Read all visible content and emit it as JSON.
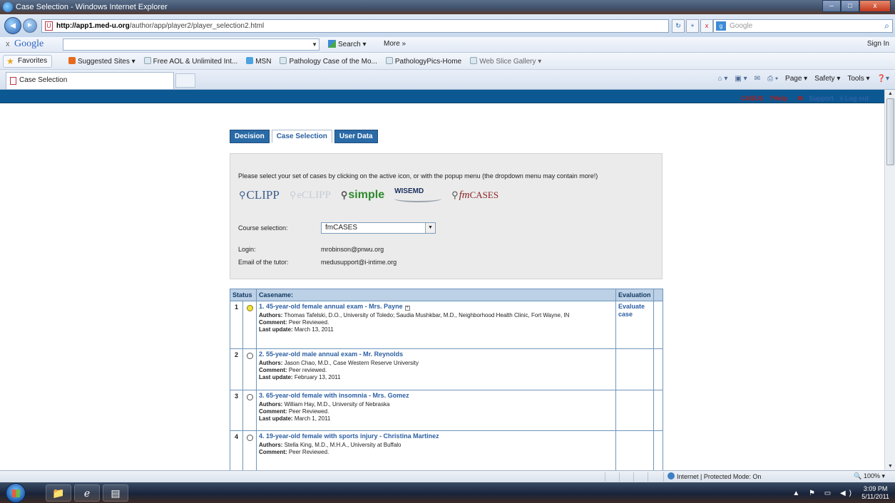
{
  "window": {
    "title": "Case Selection - Windows Internet Explorer",
    "minimize": "–",
    "maximize": "□",
    "close": "x"
  },
  "browser": {
    "back": "◄",
    "forward": "►",
    "url_domain": "http://app1.med-u.org",
    "url_path": "/author/app/player2/player_selection2.html",
    "addr_refresh": "↻",
    "addr_compat": "+",
    "addr_stop": "x",
    "google_box_text": "Google",
    "google_search_icon": "⌕",
    "google_toolbar": {
      "close": "x",
      "logo": "Google",
      "search_label": "Search ▾",
      "more_label": "More »",
      "signin_label": "Sign In"
    },
    "favorites": {
      "button_label": "Favorites",
      "links": [
        "Suggested Sites ▾",
        "Free AOL & Unlimited Int...",
        "MSN",
        "Pathology Case of the Mo...",
        "PathologyPics-Home",
        "Web Slice Gallery ▾"
      ]
    },
    "tab_label": "Case Selection",
    "command_bar": [
      "Page ▾",
      "Safety ▾",
      "Tools ▾"
    ]
  },
  "top_links": {
    "casus": "CASUS",
    "help": "?Help",
    "support": "Support",
    "logout": "x Log out"
  },
  "app_tabs": [
    "Decision",
    "Case Selection",
    "User Data"
  ],
  "selection_panel": {
    "intro": "Please select your set of cases by clicking on the active icon, or with the popup menu (the dropdown menu may contain more!)",
    "logos": {
      "clipp": "CLIPP",
      "eclipp": "eCLIPP",
      "simple": "simple",
      "wisemd": "WISEMD",
      "fm": "fm",
      "cases": "CASES"
    },
    "course_label": "Course selection:",
    "course_value": "fmCASES",
    "login_label": "Login:",
    "login_value": "mrobinson@pnwu.org",
    "tutor_label": "Email of the tutor:",
    "tutor_value": "medusupport@i-intime.org"
  },
  "case_table": {
    "headers": [
      "Status",
      "Casename:",
      "Evaluation"
    ],
    "labels": {
      "authors": "Authors:",
      "comment": "Comment:",
      "update": "Last update:"
    },
    "rows": [
      {
        "num": "1",
        "selected": true,
        "title": "1. 45-year-old female annual exam - Mrs. Payne",
        "authors": "Thomas Tafelski, D.O., University of Toledo; Saudia Mushkbar, M.D., Neighborhood Health Clinic, Fort Wayne, IN",
        "comment": "Peer Reviewed.",
        "update": "March 13, 2011",
        "evaluation": "Evaluate case"
      },
      {
        "num": "2",
        "selected": false,
        "title": "2. 55-year-old male annual exam - Mr. Reynolds",
        "authors": "Jason Chao, M.D., Case Western Reserve University",
        "comment": "Peer reviewed.",
        "update": "February 13, 2011",
        "evaluation": ""
      },
      {
        "num": "3",
        "selected": false,
        "title": "3. 65-year-old female with insomnia - Mrs. Gomez",
        "authors": "William Hay, M.D., University of Nebraska",
        "comment": "Peer Reviewed.",
        "update": "March 1, 2011",
        "evaluation": ""
      },
      {
        "num": "4",
        "selected": false,
        "title": "4. 19-year-old female with sports injury - Christina Martinez",
        "authors": "Stella King, M.D., M.H.A., University at Buffalo",
        "comment": "Peer Reviewed.",
        "update": "",
        "evaluation": ""
      }
    ]
  },
  "status_bar": {
    "zone": "Internet | Protected Mode: On",
    "zoom": "100%"
  },
  "taskbar": {
    "time": "3:09 PM",
    "date": "5/11/2011"
  },
  "colors": {
    "header_bar": "#0c5892",
    "tab_inactive": "#2a6aa6",
    "link": "#2d60a3",
    "panel": "#ebebeb"
  }
}
